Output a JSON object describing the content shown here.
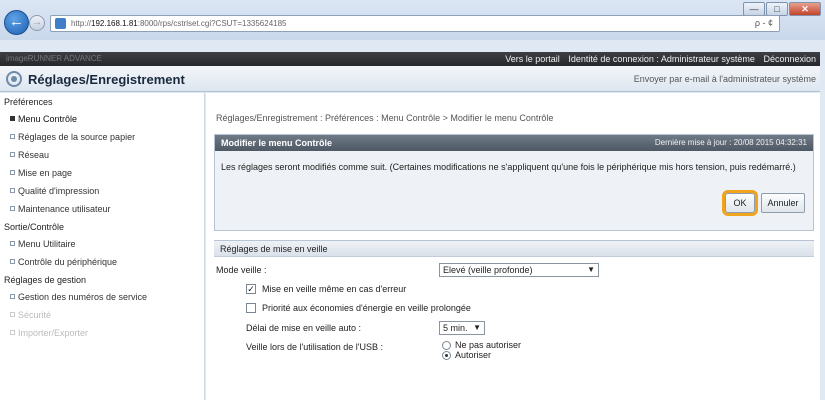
{
  "browser": {
    "back_glyph": "←",
    "forward_glyph": "→",
    "url_prefix": "http://",
    "url_host": "192.168.1.81",
    "url_rest": ":8000/rps/cstrlset.cgi?CSUT=1335624185",
    "addr_right": "ρ - ¢",
    "win_minimize": "—",
    "win_maximize": "□",
    "win_close": "✕"
  },
  "banner": {
    "left": "imageRUNNER ADVANCE",
    "portal": "Vers le portail",
    "login_id": "Identité de connexion : Administrateur système",
    "logout": "Déconnexion"
  },
  "titlebar": {
    "title": "Réglages/Enregistrement",
    "mail_link": "Envoyer par e-mail à l'administrateur système"
  },
  "sidebar": {
    "sections": [
      {
        "title": "Préférences",
        "items": [
          {
            "label": "Menu Contrôle",
            "state": "active"
          },
          {
            "label": "Réglages de la source papier",
            "state": "normal"
          },
          {
            "label": "Réseau",
            "state": "normal"
          },
          {
            "label": "Mise en page",
            "state": "normal"
          },
          {
            "label": "Qualité d'impression",
            "state": "normal"
          },
          {
            "label": "Maintenance utilisateur",
            "state": "normal"
          }
        ]
      },
      {
        "title": "Sortie/Contrôle",
        "items": [
          {
            "label": "Menu Utilitaire",
            "state": "normal"
          },
          {
            "label": "Contrôle du périphérique",
            "state": "normal"
          }
        ]
      },
      {
        "title": "Réglages de gestion",
        "items": [
          {
            "label": "Gestion des numéros de service",
            "state": "normal"
          },
          {
            "label": "Sécurité",
            "state": "faded"
          },
          {
            "label": "Importer/Exporter",
            "state": "faded"
          }
        ]
      }
    ]
  },
  "main": {
    "breadcrumb": "Réglages/Enregistrement : Préférences : Menu Contrôle > Modifier le menu Contrôle",
    "confirm_panel": {
      "title": "Modifier le menu Contrôle",
      "last_update": "Dernière mise à jour : 20/08 2015 04:32:31",
      "message": "Les réglages seront modifiés comme suit. (Certaines modifications ne s'appliquent qu'une fois le périphérique mis hors tension, puis redémarré.)",
      "ok_label": "OK",
      "cancel_label": "Annuler"
    },
    "sleep_panel": {
      "title": "Réglages de mise en veille",
      "sleep_mode_label": "Mode veille :",
      "sleep_mode_value": "Elevé (veille profonde)",
      "error_sleep_label": "Mise en veille même en cas d'erreur",
      "error_sleep_checked": true,
      "energy_priority_label": "Priorité aux économies d'énergie en veille prolongée",
      "energy_priority_checked": false,
      "auto_delay_label": "Délai de mise en veille auto :",
      "auto_delay_value": "5 min.",
      "usb_label": "Veille lors de l'utilisation de l'USB :",
      "usb_options": [
        "Ne pas autoriser",
        "Autoriser"
      ],
      "usb_selected": "Autoriser"
    }
  },
  "colors": {
    "accent_highlight": "#f0a31c",
    "panel_header": "#5a6470",
    "banner": "#2e3035"
  }
}
